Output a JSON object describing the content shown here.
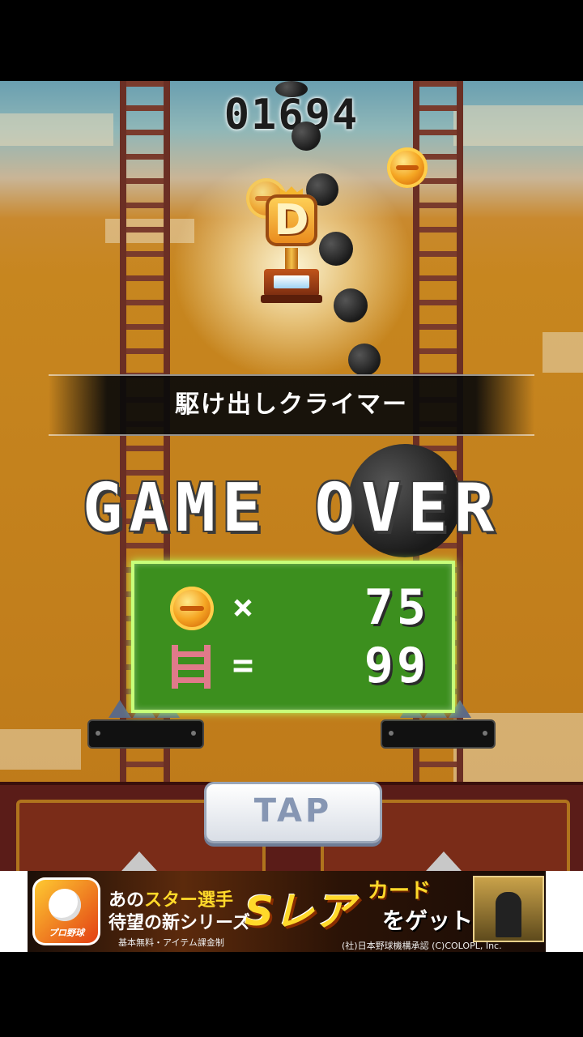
{
  "game": {
    "score": "01694",
    "achievement_title": "駆け出しクライマー",
    "trophy_rank": "D",
    "game_over_text": "GAME OVER",
    "results": {
      "coins_operator": "×",
      "coins_value": "75",
      "ladders_operator": "=",
      "ladders_value": "99"
    },
    "tap_label": "TAP"
  },
  "ad": {
    "line1_prefix": "あの",
    "line1_highlight": "スター選手",
    "line2": "待望の新シリーズ",
    "headline": "Sレア",
    "card_word": "カード",
    "get_text": "をゲット!!",
    "pricing_note": "基本無料・アイテム課金制",
    "legal": "(社)日本野球機構承認 (C)COLOPL, Inc.",
    "logo_brand": "プロ野球"
  },
  "colors": {
    "result_panel": "#3c8f1e",
    "result_border": "#c8ff7a",
    "coin": "#f5a623",
    "ladder_icon": "#e07a8a"
  },
  "icons": [
    "coin-icon",
    "ladder-icon",
    "trophy-icon",
    "spike-ball-icon"
  ]
}
